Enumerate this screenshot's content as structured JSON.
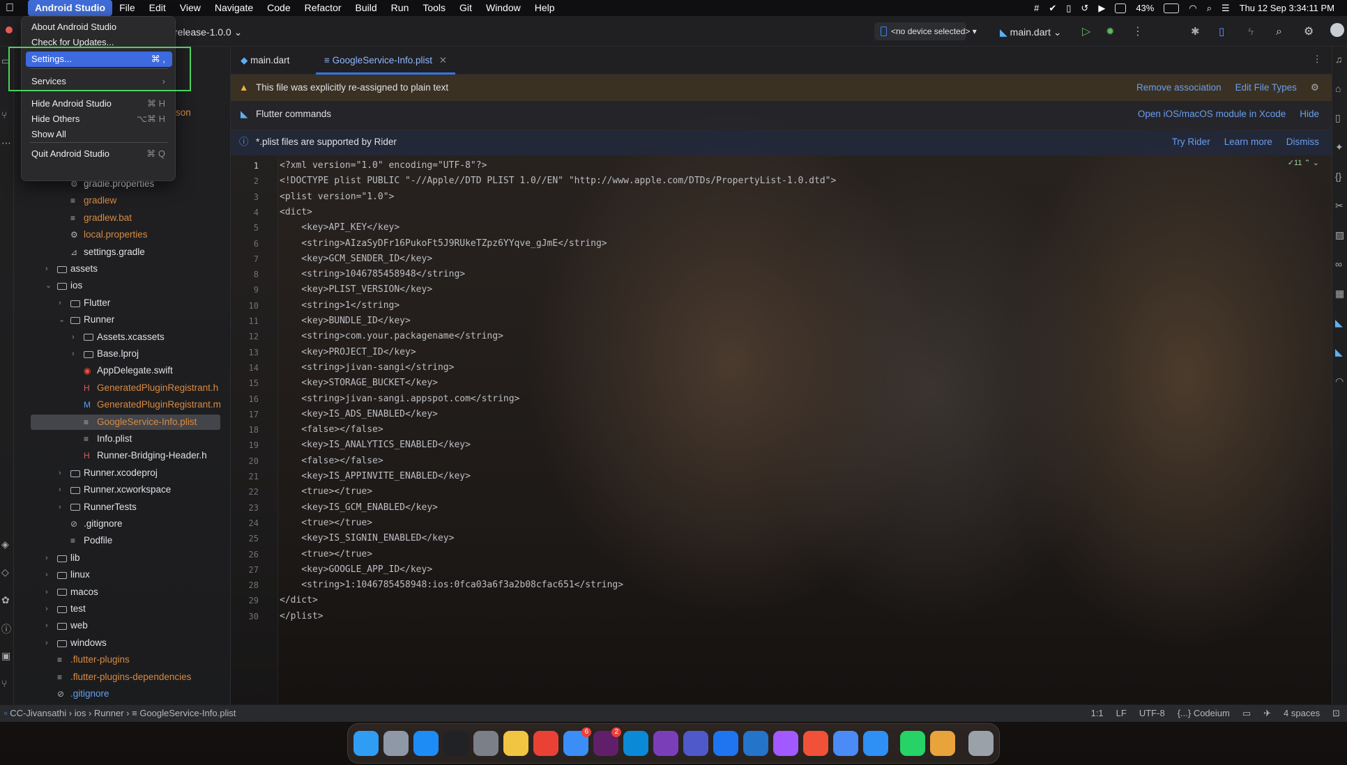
{
  "menubar": {
    "app": "Android Studio",
    "items": [
      "File",
      "Edit",
      "View",
      "Navigate",
      "Code",
      "Refactor",
      "Build",
      "Run",
      "Tools",
      "Git",
      "Window",
      "Help"
    ],
    "battery": "43%",
    "datetime": "Thu 12 Sep  3:34:11 PM"
  },
  "toolbar": {
    "branch": "release-1.0.0",
    "device": "<no device selected>",
    "run_config": "main.dart"
  },
  "tabs": [
    {
      "label": "main.dart"
    },
    {
      "label": "GoogleService-Info.plist"
    }
  ],
  "banners": {
    "reassign": {
      "text": "This file was explicitly re-assigned to plain text",
      "actions": [
        "Remove association",
        "Edit File Types"
      ]
    },
    "flutter": {
      "text": "Flutter commands",
      "actions": [
        "Open iOS/macOS module in Xcode",
        "Hide"
      ]
    },
    "rider": {
      "text": "*.plist files are supported by Rider",
      "actions": [
        "Try Rider",
        "Learn more",
        "Dismiss"
      ]
    }
  },
  "inspections": {
    "count": "11"
  },
  "code_lines": [
    "<?xml version=\"1.0\" encoding=\"UTF-8\"?>",
    "<!DOCTYPE plist PUBLIC \"-//Apple//DTD PLIST 1.0//EN\" \"http://www.apple.com/DTDs/PropertyList-1.0.dtd\">",
    "<plist version=\"1.0\">",
    "<dict>",
    "    <key>API_KEY</key>",
    "    <string>AIzaSyDFr16PukoFt5J9RUkeTZpz6YYqve_gJmE</string>",
    "    <key>GCM_SENDER_ID</key>",
    "    <string>1046785458948</string>",
    "    <key>PLIST_VERSION</key>",
    "    <string>1</string>",
    "    <key>BUNDLE_ID</key>",
    "    <string>com.your.packagename</string>",
    "    <key>PROJECT_ID</key>",
    "    <string>jivan-sangi</string>",
    "    <key>STORAGE_BUCKET</key>",
    "    <string>jivan-sangi.appspot.com</string>",
    "    <key>IS_ADS_ENABLED</key>",
    "    <false></false>",
    "    <key>IS_ANALYTICS_ENABLED</key>",
    "    <false></false>",
    "    <key>IS_APPINVITE_ENABLED</key>",
    "    <true></true>",
    "    <key>IS_GCM_ENABLED</key>",
    "    <true></true>",
    "    <key>IS_SIGNIN_ENABLED</key>",
    "    <true></true>",
    "    <key>GOOGLE_APP_ID</key>",
    "    <string>1:1046785458948:ios:0fca03a6f3a2b08cfac651</string>",
    "</dict>",
    "</plist>"
  ],
  "line_numbers": [
    "1",
    "2",
    "3",
    "4",
    "5",
    "6",
    "7",
    "8",
    "9",
    "10",
    "11",
    "12",
    "13",
    "14",
    "15",
    "16",
    "17",
    "18",
    "19",
    "20",
    "21",
    "22",
    "23",
    "24",
    "25",
    "26",
    "27",
    "28",
    "29",
    "30"
  ],
  "project_tree": [
    {
      "label": "gradle.properties",
      "depth": 3,
      "kind": "gear",
      "color": "normal"
    },
    {
      "label": "gradlew",
      "depth": 3,
      "kind": "file",
      "color": "orange"
    },
    {
      "label": "gradlew.bat",
      "depth": 3,
      "kind": "file",
      "color": "orange"
    },
    {
      "label": "local.properties",
      "depth": 3,
      "kind": "gear",
      "color": "orange"
    },
    {
      "label": "settings.gradle",
      "depth": 3,
      "kind": "gradle",
      "color": "normal"
    },
    {
      "label": "assets",
      "depth": 2,
      "kind": "folder",
      "chevron": "closed",
      "color": "normal"
    },
    {
      "label": "ios",
      "depth": 2,
      "kind": "folder",
      "chevron": "open",
      "color": "normal"
    },
    {
      "label": "Flutter",
      "depth": 3,
      "kind": "folder",
      "chevron": "closed",
      "color": "normal"
    },
    {
      "label": "Runner",
      "depth": 3,
      "kind": "folder",
      "chevron": "open",
      "color": "normal"
    },
    {
      "label": "Assets.xcassets",
      "depth": 4,
      "kind": "folder",
      "chevron": "closed",
      "color": "normal"
    },
    {
      "label": "Base.lproj",
      "depth": 4,
      "kind": "folder",
      "chevron": "closed",
      "color": "normal"
    },
    {
      "label": "AppDelegate.swift",
      "depth": 4,
      "kind": "swift",
      "color": "normal"
    },
    {
      "label": "GeneratedPluginRegistrant.h",
      "depth": 4,
      "kind": "h",
      "color": "orange"
    },
    {
      "label": "GeneratedPluginRegistrant.m",
      "depth": 4,
      "kind": "m",
      "color": "orange"
    },
    {
      "label": "GoogleService-Info.plist",
      "depth": 4,
      "kind": "file",
      "color": "orange",
      "selected": true
    },
    {
      "label": "Info.plist",
      "depth": 4,
      "kind": "file",
      "color": "normal"
    },
    {
      "label": "Runner-Bridging-Header.h",
      "depth": 4,
      "kind": "h",
      "color": "normal"
    },
    {
      "label": "Runner.xcodeproj",
      "depth": 3,
      "kind": "folder",
      "chevron": "closed",
      "color": "normal"
    },
    {
      "label": "Runner.xcworkspace",
      "depth": 3,
      "kind": "folder",
      "chevron": "closed",
      "color": "normal"
    },
    {
      "label": "RunnerTests",
      "depth": 3,
      "kind": "folder",
      "chevron": "closed",
      "color": "normal"
    },
    {
      "label": ".gitignore",
      "depth": 3,
      "kind": "ignore",
      "color": "normal"
    },
    {
      "label": "Podfile",
      "depth": 3,
      "kind": "file",
      "color": "normal"
    },
    {
      "label": "lib",
      "depth": 2,
      "kind": "folder",
      "chevron": "closed",
      "color": "normal"
    },
    {
      "label": "linux",
      "depth": 2,
      "kind": "folder",
      "chevron": "closed",
      "color": "normal"
    },
    {
      "label": "macos",
      "depth": 2,
      "kind": "folder",
      "chevron": "closed",
      "color": "normal"
    },
    {
      "label": "test",
      "depth": 2,
      "kind": "folder",
      "chevron": "closed",
      "color": "normal"
    },
    {
      "label": "web",
      "depth": 2,
      "kind": "folder",
      "chevron": "closed",
      "color": "normal"
    },
    {
      "label": "windows",
      "depth": 2,
      "kind": "folder",
      "chevron": "closed",
      "color": "normal"
    },
    {
      "label": ".flutter-plugins",
      "depth": 2,
      "kind": "file",
      "color": "orange"
    },
    {
      "label": ".flutter-plugins-dependencies",
      "depth": 2,
      "kind": "file",
      "color": "orange"
    },
    {
      "label": ".gitignore",
      "depth": 2,
      "kind": "ignore",
      "color": "blue"
    }
  ],
  "tree_partial": "son",
  "app_menu": {
    "items": [
      {
        "label": "About Android Studio",
        "shortcut": ""
      },
      {
        "label": "Check for Updates...",
        "shortcut": ""
      },
      {
        "label": "Settings...",
        "shortcut": "⌘ ,",
        "highlighted": true
      },
      {
        "label": "Services",
        "shortcut": "›"
      },
      {
        "label": "Hide Android Studio",
        "shortcut": "⌘ H"
      },
      {
        "label": "Hide Others",
        "shortcut": "⌥⌘ H"
      },
      {
        "label": "Show All",
        "shortcut": ""
      },
      {
        "label": "Quit Android Studio",
        "shortcut": "⌘ Q"
      }
    ]
  },
  "statusbar": {
    "breadcrumbs": [
      "CC-Jivansathi",
      "ios",
      "Runner",
      "GoogleService-Info.plist"
    ],
    "position": "1:1",
    "line_sep": "LF",
    "encoding": "UTF-8",
    "plugin": "{...} Codeium",
    "indent": "4 spaces"
  },
  "dock": {
    "apps": [
      "Finder",
      "Launchpad",
      "App Store",
      "Terminal",
      "System Settings",
      "Notes",
      "Chrome",
      "Mail",
      "Slack",
      "Skype",
      "GitHub Desktop",
      "Teams",
      "Xcode Instruments",
      "VS Code",
      "Figma",
      "Swift Playgrounds",
      "Android Studio",
      "Safari",
      "WhatsApp",
      "Chrome Canary",
      "Trash"
    ],
    "colors": [
      "#2f9df4",
      "#8f98a6",
      "#1d8cf5",
      "#202226",
      "#7a7f88",
      "#f1c542",
      "#e94235",
      "#3a8ef6",
      "#611f69",
      "#0a8ad6",
      "#7a3fb8",
      "#5059c9",
      "#1f74f0",
      "#2474c9",
      "#a259ff",
      "#f05138",
      "#4a8bf5",
      "#2e8ff5",
      "#25d366",
      "#e8a33a",
      "#9aa1a9"
    ],
    "badges": {
      "Mail": "6",
      "Slack": "2"
    }
  },
  "colors": {
    "accent": "#3574f0",
    "selection": "#43454a",
    "highlight": "#3e6ae0",
    "menu_outline": "#49d35e"
  }
}
